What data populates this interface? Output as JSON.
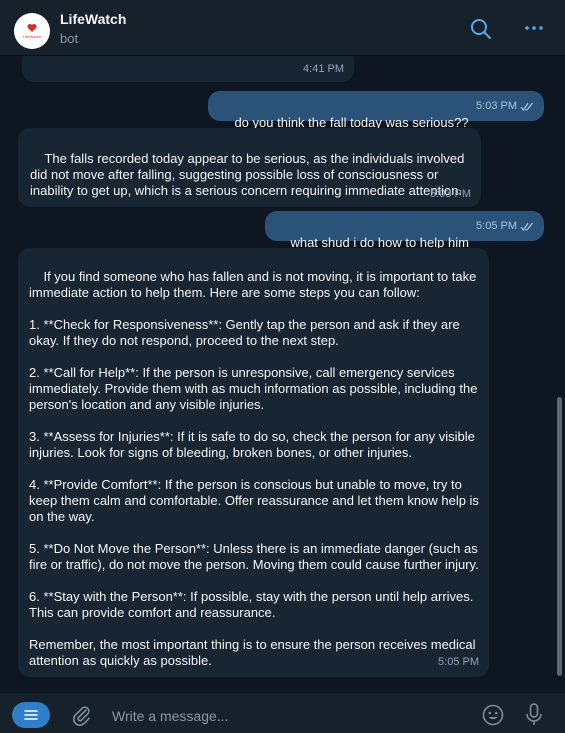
{
  "header": {
    "title": "LifeWatch",
    "subtitle": "bot",
    "avatar_text": "LifeWatch"
  },
  "messages": [
    {
      "direction": "in",
      "text": "",
      "time": "4:41 PM"
    },
    {
      "direction": "out",
      "text": "do you think the fall today was serious??",
      "time": "5:03 PM",
      "read": true
    },
    {
      "direction": "in",
      "text": "The falls recorded today appear to be serious, as the individuals involved did not move after falling, suggesting possible loss of consciousness or inability to get up, which is a serious concern requiring immediate attention.",
      "time": "5:03 PM"
    },
    {
      "direction": "out",
      "text": "what shud i do how to help him",
      "time": "5:05 PM",
      "read": true
    },
    {
      "direction": "in",
      "text": "If you find someone who has fallen and is not moving, it is important to take immediate action to help them. Here are some steps you can follow:\n\n1. **Check for Responsiveness**: Gently tap the person and ask if they are okay. If they do not respond, proceed to the next step.\n\n2. **Call for Help**: If the person is unresponsive, call emergency services immediately. Provide them with as much information as possible, including the person's location and any visible injuries.\n\n3. **Assess for Injuries**: If it is safe to do so, check the person for any visible injuries. Look for signs of bleeding, broken bones, or other injuries.\n\n4. **Provide Comfort**: If the person is conscious but unable to move, try to keep them calm and comfortable. Offer reassurance and let them know help is on the way.\n\n5. **Do Not Move the Person**: Unless there is an immediate danger (such as fire or traffic), do not move the person. Moving them could cause further injury.\n\n6. **Stay with the Person**: If possible, stay with the person until help arrives. This can provide comfort and reassurance.\n\nRemember, the most important thing is to ensure the person receives medical attention as quickly as possible.",
      "time": "5:05 PM"
    }
  ],
  "composer": {
    "placeholder": "Write a message..."
  },
  "colors": {
    "background": "#0e1621",
    "header": "#17212b",
    "incoming_bubble": "#182533",
    "outgoing_bubble": "#2b5278",
    "accent": "#2f7ec9"
  }
}
